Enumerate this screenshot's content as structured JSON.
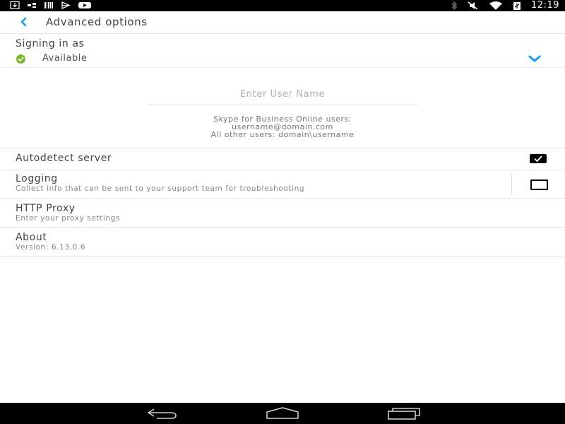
{
  "status_bar": {
    "time": "12:19",
    "left_icons": [
      "download-icon",
      "sim-icon",
      "barcode-icon",
      "play-store-icon",
      "youtube-icon"
    ],
    "right_icons": [
      "bluetooth-icon",
      "mute-icon",
      "wifi-icon",
      "battery-icon"
    ]
  },
  "header": {
    "title": "Advanced options"
  },
  "signing": {
    "label": "Signing in as",
    "status": "Available",
    "status_color": "#7cb82f"
  },
  "username": {
    "placeholder": "Enter User Name",
    "value": "",
    "hint_lines": [
      "Skype for Business Online users:",
      "username@domain.com",
      "All other users: domain\\username"
    ]
  },
  "settings": {
    "autodetect": {
      "title": "Autodetect server",
      "checked": true
    },
    "logging": {
      "title": "Logging",
      "subtitle": "Collect info that can be sent to your support team for troubleshooting",
      "checked": false
    },
    "proxy": {
      "title": "HTTP Proxy",
      "subtitle": "Enter your proxy settings"
    },
    "about": {
      "title": "About",
      "subtitle": "Version: 6.13.0.6"
    }
  },
  "colors": {
    "accent": "#1ba1e2",
    "available": "#7cb82f"
  },
  "nav_bar": {
    "icons": [
      "back-nav-icon",
      "home-nav-icon",
      "recents-nav-icon"
    ]
  }
}
